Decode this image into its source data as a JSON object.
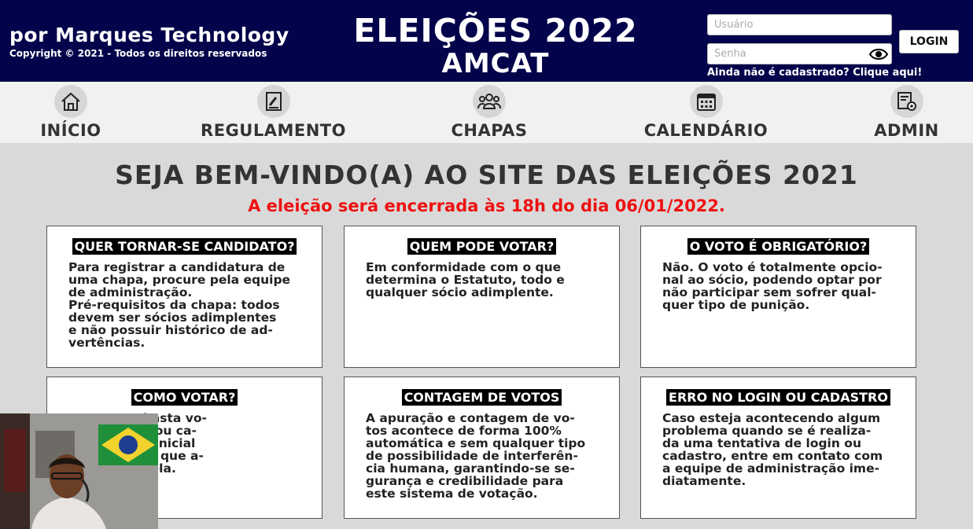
{
  "header": {
    "brand": "por Marques Technology",
    "copyright": "Copyright © 2021 - Todos os direitos reservados",
    "title_line1": "ELEIÇÕES 2022",
    "title_line2": "AMCAT",
    "username_placeholder": "Usuário",
    "password_placeholder": "Senha",
    "login_label": "LOGIN",
    "signup_link": "Ainda não é cadastrado? Clique aqui!"
  },
  "nav": [
    {
      "label": "INÍCIO",
      "icon": "home-icon"
    },
    {
      "label": "REGULAMENTO",
      "icon": "gavel-icon"
    },
    {
      "label": "CHAPAS",
      "icon": "group-icon"
    },
    {
      "label": "CALENDÁRIO",
      "icon": "calendar-icon"
    },
    {
      "label": "ADMIN",
      "icon": "admin-settings-icon"
    }
  ],
  "main": {
    "welcome": "SEJA BEM-VINDO(A) AO SITE DAS ELEIÇÕES 2021",
    "deadline": "A eleição será encerrada às 18h do dia 06/01/2022.",
    "deadline_color": "#ee1111"
  },
  "cards": [
    {
      "title": "QUER TORNAR-SE CANDIDATO?",
      "body": "Para registrar a candidatura de\numa chapa, procure pela equipe\nde administração.\nPré-requisitos da chapa: todos\ndevem ser sócios adimplentes\ne não possuir histórico de ad-\nvertências."
    },
    {
      "title": "QUEM PODE VOTAR?",
      "body": "Em conformidade com o que\ndetermina o Estatuto, todo e\nqualquer sócio adimplente."
    },
    {
      "title": "O VOTO É OBRIGATÓRIO?",
      "body": "Não. O voto é totalmente opcio-\nnal ao sócio, podendo optar por\nnão participar sem sofrer qual-\nquer tipo de punição."
    },
    {
      "title": "COMO VOTAR?",
      "body": "...eu voto, basta vo-\n...seu login (ou ca-\n...na página inicial\n...ção VOTAR que a-\n...entro da tela."
    },
    {
      "title": "CONTAGEM DE VOTOS",
      "body": "A apuração e contagem de vo-\ntos acontece de forma 100%\nautomática e sem qualquer tipo\nde possibilidade de interferên-\ncia humana, garantindo-se se-\ngurança e credibilidade para\neste sistema de votação."
    },
    {
      "title": "ERRO NO LOGIN OU CADASTRO",
      "body": "Caso esteja acontecendo algum\nproblema quando se é realiza-\nda uma tentativa de login ou\ncadastro, entre em contato com\na equipe de administração ime-\ndiatamente."
    }
  ],
  "colors": {
    "header_bg": "#02034a",
    "nav_bg": "#f1f1f1",
    "page_bg": "#d9d9d9"
  }
}
